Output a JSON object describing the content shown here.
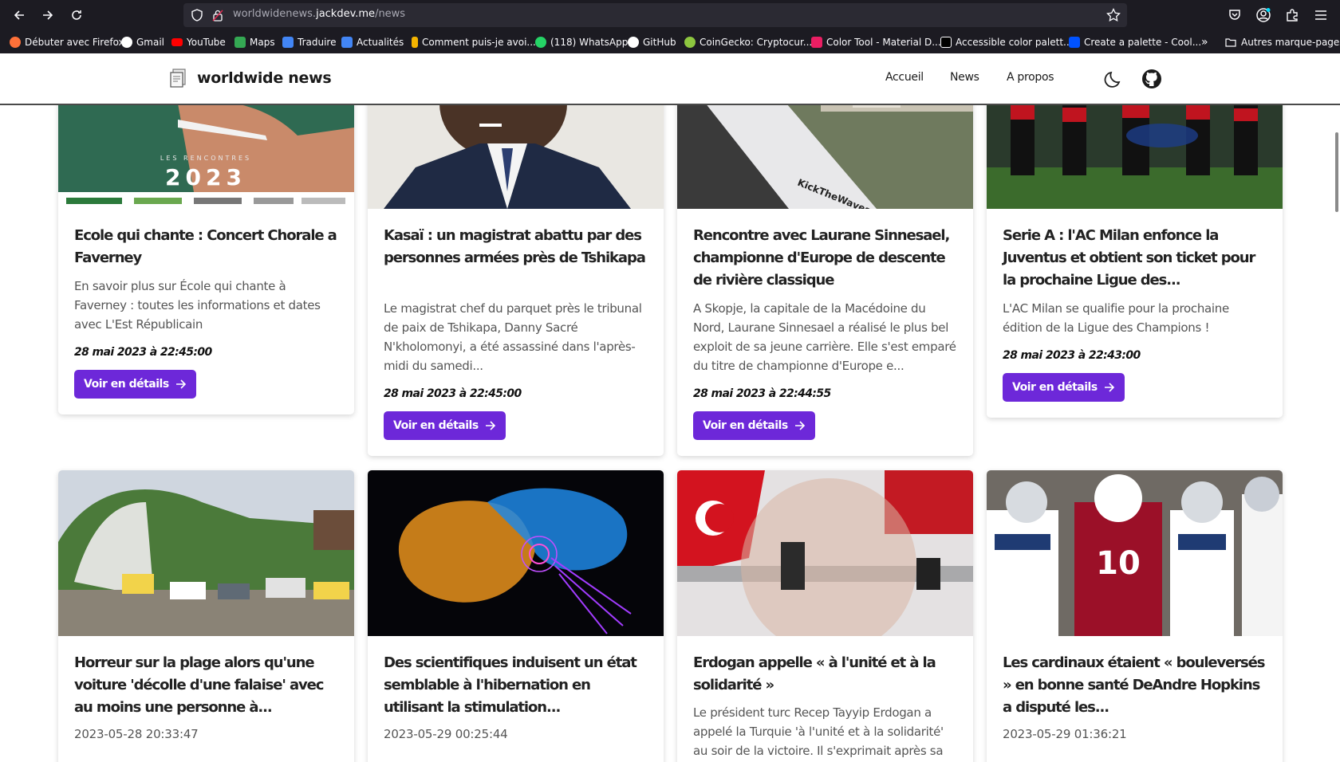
{
  "browser": {
    "url_prefix": "worldwidenews.",
    "url_domain": "jackdev.me",
    "url_path": "/news",
    "bookmarks": [
      {
        "label": "Débuter avec Firefox",
        "color": "#ff7139"
      },
      {
        "label": "Gmail",
        "color": "#ffffff"
      },
      {
        "label": "YouTube",
        "color": "#ff0000"
      },
      {
        "label": "Maps",
        "color": "#34a853"
      },
      {
        "label": "Traduire",
        "color": "#4285f4"
      },
      {
        "label": "Actualités",
        "color": "#4285f4"
      },
      {
        "label": "Comment puis-je avoi...",
        "color": "#f4b400"
      },
      {
        "label": "(118) WhatsApp",
        "color": "#25d366"
      },
      {
        "label": "GitHub",
        "color": "#ffffff"
      },
      {
        "label": "CoinGecko: Cryptocur...",
        "color": "#8dc63f"
      },
      {
        "label": "Color Tool - Material D...",
        "color": "#e91e63"
      },
      {
        "label": "Accessible color palett...",
        "color": "#000000"
      },
      {
        "label": "Create a palette - Cool...",
        "color": "#0052ff"
      },
      {
        "label": "Autres marque-pages",
        "color": "none"
      }
    ]
  },
  "site": {
    "logo_text": "worldwide news",
    "nav": [
      "Accueil",
      "News",
      "A propos"
    ],
    "accent_color": "#6d28d9"
  },
  "cards": [
    {
      "title": "Ecole qui chante : Concert Chorale a Faverney",
      "description": "En savoir plus sur École qui chante à Faverney : toutes les informations et dates avec L'Est Républicain",
      "date": "28 mai 2023 à 22:45:00",
      "button": "Voir en détails",
      "image_caption": "2023"
    },
    {
      "title": "Kasaï : un magistrat abattu par des personnes armées près de Tshikapa",
      "description": "Le magistrat chef du parquet près le tribunal de paix de Tshikapa, Danny Sacré N'kholomonyi, a été assassiné dans l'après-midi du samedi...",
      "date": "28 mai 2023 à 22:45:00",
      "button": "Voir en détails"
    },
    {
      "title": "Rencontre avec Laurane Sinnesael, championne d'Europe de descente de rivière classique",
      "description": "A Skopje, la capitale de la Macédoine du Nord, Laurane Sinnesael a réalisé le plus bel exploit de sa jeune carrière. Elle s'est emparé du titre de championne d'Europe e...",
      "date": "28 mai 2023 à 22:44:55",
      "button": "Voir en détails",
      "image_caption": "KickTheWaves"
    },
    {
      "title": "Serie A : l'AC Milan enfonce la Juventus et obtient son ticket pour la prochaine Ligue des...",
      "description": "L'AC Milan se qualifie pour la prochaine édition de la Ligue des Champions !",
      "date": "28 mai 2023 à 22:43:00",
      "button": "Voir en détails"
    },
    {
      "title": "Horreur sur la plage alors qu'une voiture 'décolle d'une falaise' avec au moins une personne à...",
      "timestamp": "2023-05-28 20:33:47"
    },
    {
      "title": "Des scientifiques induisent un état semblable à l'hibernation en utilisant la stimulation...",
      "timestamp": "2023-05-29 00:25:44"
    },
    {
      "title": "Erdogan appelle « à l'unité et à la solidarité »",
      "description": "Le président turc Recep Tayyip Erdogan a appelé la Turquie 'à l'unité et à la solidarité' au soir de la victoire. Il s'exprimait après sa"
    },
    {
      "title": "Les cardinaux étaient « bouleversés » en bonne santé DeAndre Hopkins a disputé les...",
      "timestamp": "2023-05-29 01:36:21",
      "image_caption": "10"
    }
  ]
}
